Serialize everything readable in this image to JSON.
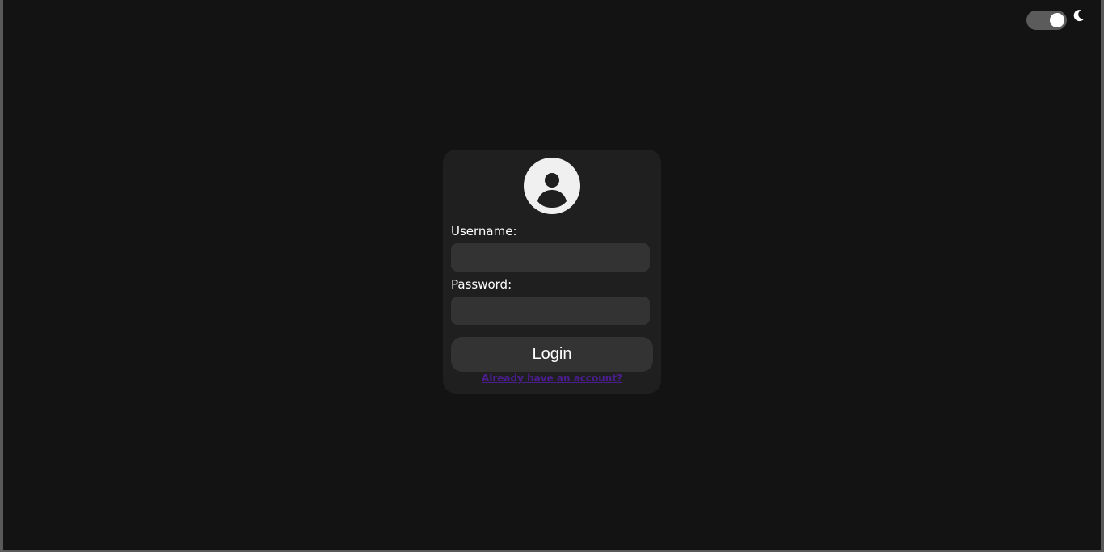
{
  "theme": {
    "toggle_state": "on",
    "moon_icon": "moon-icon"
  },
  "login_card": {
    "avatar_icon": "user-avatar-icon",
    "username_label": "Username:",
    "username_value": "",
    "password_label": "Password:",
    "password_value": "",
    "login_button": "Login",
    "account_link": "Already have an account?"
  },
  "colors": {
    "background": "#131313",
    "card": "#1f1f1f",
    "input": "#333333",
    "link": "#4b1d8f",
    "text": "#ffffff"
  }
}
